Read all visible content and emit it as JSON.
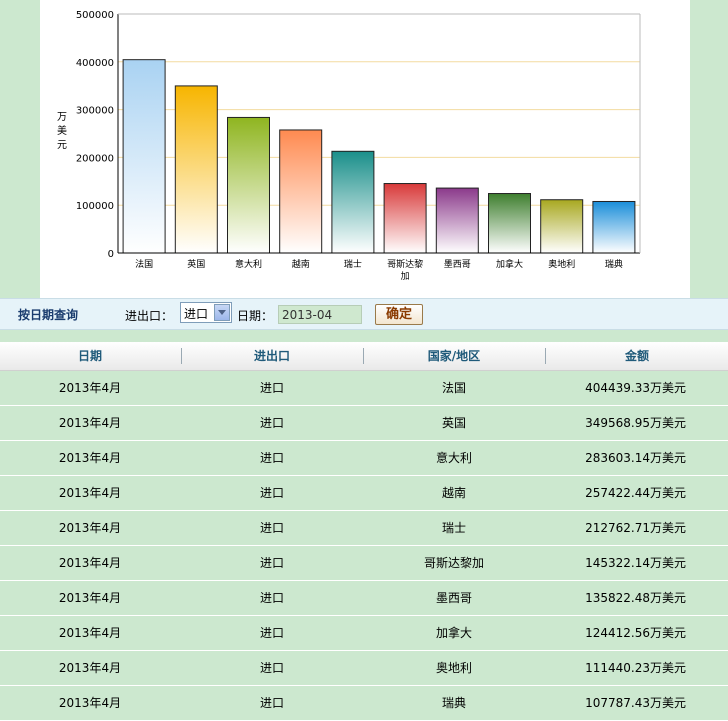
{
  "chart_data": {
    "type": "bar",
    "categories": [
      "法国",
      "英国",
      "意大利",
      "越南",
      "瑞士",
      "哥斯达黎加",
      "墨西哥",
      "加拿大",
      "奥地利",
      "瑞典"
    ],
    "category_lines": [
      [
        "法国"
      ],
      [
        "英国"
      ],
      [
        "意大利"
      ],
      [
        "越南"
      ],
      [
        "瑞士"
      ],
      [
        "哥斯达黎",
        "加"
      ],
      [
        "墨西哥"
      ],
      [
        "加拿大"
      ],
      [
        "奥地利"
      ],
      [
        "瑞典"
      ]
    ],
    "values": [
      404439.33,
      349568.95,
      283603.14,
      257422.44,
      212762.71,
      145322.14,
      135822.48,
      124412.56,
      111440.23,
      107787.43
    ],
    "ylabel": "万美元",
    "ylim": [
      0,
      500000
    ],
    "yticks": [
      "0",
      "100000",
      "200000",
      "300000",
      "400000",
      "500000"
    ],
    "grid": true,
    "bar_colors": [
      [
        "#a9d2f2",
        "#ffffff"
      ],
      [
        "#f7b500",
        "#ffffff"
      ],
      [
        "#8fb520",
        "#ffffff"
      ],
      [
        "#ff8a50",
        "#ffffff"
      ],
      [
        "#1a8f8a",
        "#ffffff"
      ],
      [
        "#d83a3a",
        "#ffffff"
      ],
      [
        "#8b3a8b",
        "#ffffff"
      ],
      [
        "#3f7f2f",
        "#ffffff"
      ],
      [
        "#a8a820",
        "#ffffff"
      ],
      [
        "#1a8ed9",
        "#ffffff"
      ]
    ]
  },
  "query": {
    "title": "按日期查询",
    "io_label": "进出口：",
    "io_selected": "进口",
    "date_label": "日期：",
    "date_value": "2013-04",
    "confirm_label": "确定"
  },
  "table": {
    "headers": [
      "日期",
      "进出口",
      "国家/地区",
      "金额"
    ],
    "rows": [
      [
        "2013年4月",
        "进口",
        "法国",
        "404439.33万美元"
      ],
      [
        "2013年4月",
        "进口",
        "英国",
        "349568.95万美元"
      ],
      [
        "2013年4月",
        "进口",
        "意大利",
        "283603.14万美元"
      ],
      [
        "2013年4月",
        "进口",
        "越南",
        "257422.44万美元"
      ],
      [
        "2013年4月",
        "进口",
        "瑞士",
        "212762.71万美元"
      ],
      [
        "2013年4月",
        "进口",
        "哥斯达黎加",
        "145322.14万美元"
      ],
      [
        "2013年4月",
        "进口",
        "墨西哥",
        "135822.48万美元"
      ],
      [
        "2013年4月",
        "进口",
        "加拿大",
        "124412.56万美元"
      ],
      [
        "2013年4月",
        "进口",
        "奥地利",
        "111440.23万美元"
      ],
      [
        "2013年4月",
        "进口",
        "瑞典",
        "107787.43万美元"
      ]
    ]
  }
}
